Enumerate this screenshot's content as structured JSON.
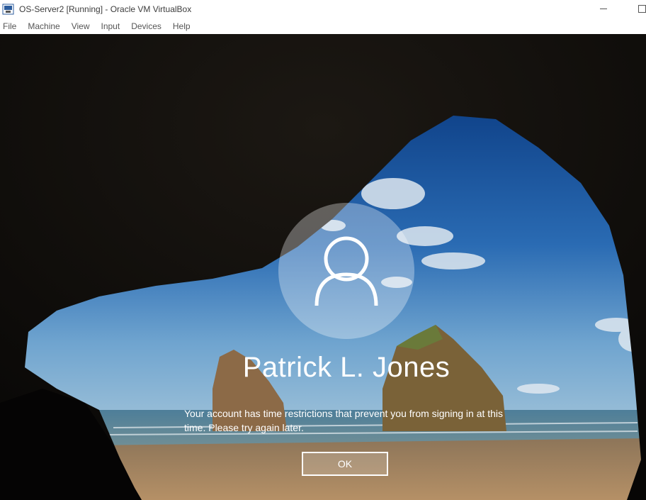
{
  "window": {
    "title": "OS-Server2 [Running] - Oracle VM VirtualBox",
    "icon": "virtualbox-app-icon"
  },
  "menubar": {
    "items": [
      "File",
      "Machine",
      "View",
      "Input",
      "Devices",
      "Help"
    ]
  },
  "login": {
    "user_name": "Patrick L. Jones",
    "message": "Your account has time restrictions that prevent you from signing in at this time. Please try again later.",
    "ok_label": "OK",
    "avatar_icon": "user-icon"
  },
  "colors": {
    "sky": "#1c5fa8",
    "cave": "#0f0d0b",
    "sand": "#b08a5e",
    "avatar_bg": "rgba(255,255,255,0.32)"
  }
}
